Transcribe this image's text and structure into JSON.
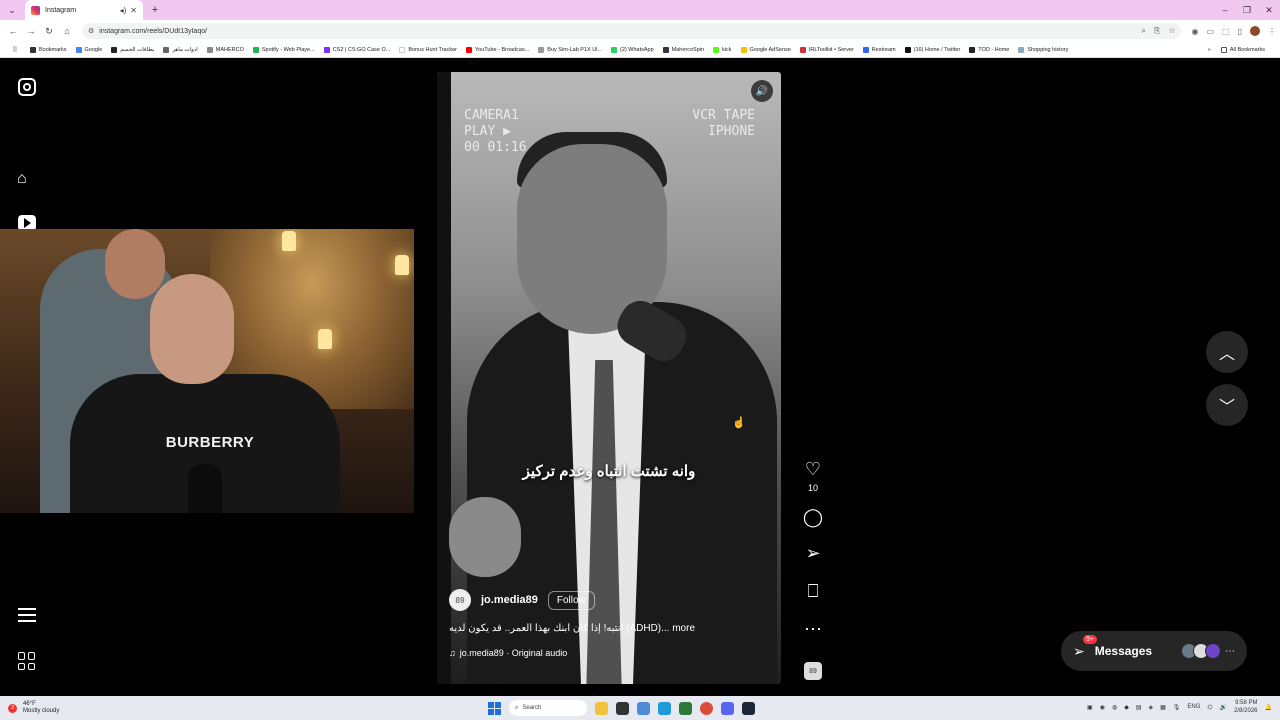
{
  "browser": {
    "tab_title": "Instagram",
    "url": "instagram.com/reels/DUdt13yIaqo/",
    "bookmarks": [
      {
        "label": "Bookmarks",
        "color": "#333"
      },
      {
        "label": "Google",
        "color": "#4285f4"
      },
      {
        "label": "بطاقات الجسم",
        "color": "#222"
      },
      {
        "label": "ادوات ماهر",
        "color": "#666"
      },
      {
        "label": "MAHERCO",
        "color": "#888"
      },
      {
        "label": "Spotify - Web Playe...",
        "color": "#1db954"
      },
      {
        "label": "CS2 | CS:GO Case O...",
        "color": "#7b2ff7"
      },
      {
        "label": "Bonus Hunt Tracker",
        "color": "#fff"
      },
      {
        "label": "YouTube - Broadcas...",
        "color": "#ff0000"
      },
      {
        "label": "Buy Sim-Lab P1X Ul...",
        "color": "#999"
      },
      {
        "label": "(2) WhatsApp",
        "color": "#25d366"
      },
      {
        "label": "MahercoSpin",
        "color": "#334"
      },
      {
        "label": "kick",
        "color": "#53fc18"
      },
      {
        "label": "Google AdSense",
        "color": "#fbbc05"
      },
      {
        "label": "IRLToolkit • Server",
        "color": "#c33"
      },
      {
        "label": "Restream",
        "color": "#2b6be6"
      },
      {
        "label": "(16) Home / Twitter",
        "color": "#111"
      },
      {
        "label": "TOD - Home",
        "color": "#222"
      },
      {
        "label": "Shopping history",
        "color": "#8ab"
      }
    ],
    "all_bookmarks": "All Bookmarks"
  },
  "reel": {
    "vcr_top_left": [
      "CAMERA1",
      "PLAY ▶",
      "00 01:16"
    ],
    "vcr_top_right": [
      "VCR TAPE",
      "IPHONE"
    ],
    "caption_overlay": "وانه تشتت انتباه وعدم تركيز",
    "author": "jo.media89",
    "follow_label": "Follow",
    "caption": "انتبه! إذا كان ابنك بهذا العمر.. قد يكون لديه (ADHD)... more",
    "audio": "jo.media89 · Original audio",
    "avatar_text": "89"
  },
  "actions": {
    "like_count": "10"
  },
  "webcam": {
    "shirt_brand": "BURBERRY"
  },
  "messages": {
    "label": "Messages",
    "badge": "9+"
  },
  "taskbar": {
    "weather_temp": "46°F",
    "weather_desc": "Mostly cloudy",
    "weather_badge": "3",
    "search_label": "Search",
    "lang": "ENG",
    "time": "9:58 PM",
    "date": "2/8/2026"
  }
}
